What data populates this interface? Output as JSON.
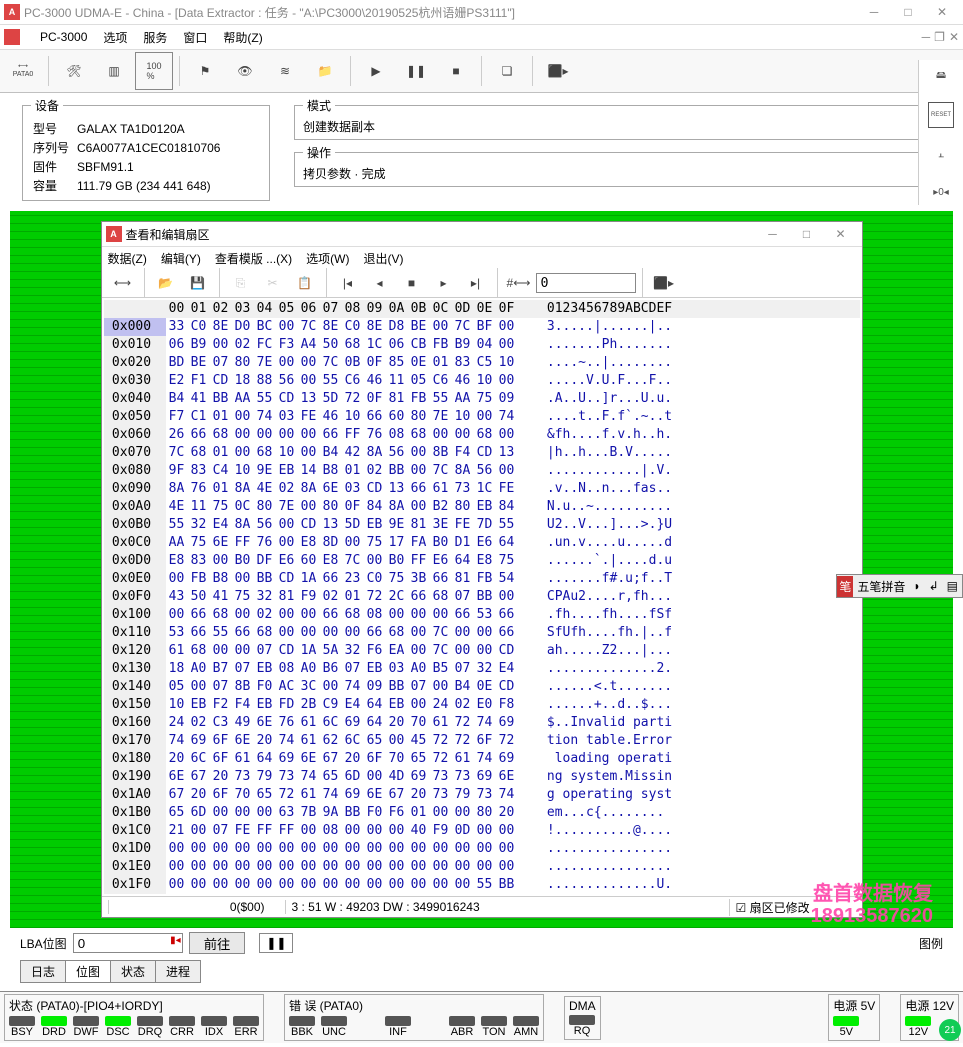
{
  "window": {
    "title": "PC-3000 UDMA-E - China - [Data Extractor : 任务 - \"A:\\PC3000\\20190525杭州语姗PS3111\"]"
  },
  "menu": {
    "main1": "PC-3000",
    "main2": "选项",
    "main3": "服务",
    "main4": "窗口",
    "main5": "帮助(Z)"
  },
  "device": {
    "legend": "设备",
    "model_k": "型号",
    "model_v": "GALAX TA1D0120A",
    "serial_k": "序列号",
    "serial_v": "C6A0077A1CEC01810706",
    "fw_k": "固件",
    "fw_v": "SBFM91.1",
    "cap_k": "容量",
    "cap_v": "111.79 GB (234 441 648)"
  },
  "mode": {
    "legend": "模式",
    "val": "创建数据副本"
  },
  "oper": {
    "legend": "操作",
    "val": "拷贝参数 · 完成"
  },
  "hexwin": {
    "title": "查看和编辑扇区",
    "m_data": "数据(Z)",
    "m_edit": "编辑(Y)",
    "m_tpl": "查看模版 ...(X)",
    "m_opt": "选项(W)",
    "m_exit": "退出(V)",
    "input": "0",
    "status_l": "0($00)",
    "status_m": "3 : 51 W : 49203 DW : 3499016243",
    "status_r": "扇区已修改"
  },
  "hex": {
    "hdr": "00 01 02 03 04 05 06 07 08 09 0A 0B 0C 0D 0E 0F  0123456789ABCDEF",
    "rows": [
      {
        "a": "0x000",
        "b": "33 C0 8E D0 BC 00 7C 8E C0 8E D8 BE 00 7C BF 00",
        "t": "3.....|......|.."
      },
      {
        "a": "0x010",
        "b": "06 B9 00 02 FC F3 A4 50 68 1C 06 CB FB B9 04 00",
        "t": ".......Ph......."
      },
      {
        "a": "0x020",
        "b": "BD BE 07 80 7E 00 00 7C 0B 0F 85 0E 01 83 C5 10",
        "t": "....~..|........"
      },
      {
        "a": "0x030",
        "b": "E2 F1 CD 18 88 56 00 55 C6 46 11 05 C6 46 10 00",
        "t": ".....V.U.F...F.."
      },
      {
        "a": "0x040",
        "b": "B4 41 BB AA 55 CD 13 5D 72 0F 81 FB 55 AA 75 09",
        "t": ".A..U..]r...U.u."
      },
      {
        "a": "0x050",
        "b": "F7 C1 01 00 74 03 FE 46 10 66 60 80 7E 10 00 74",
        "t": "....t..F.f`.~..t"
      },
      {
        "a": "0x060",
        "b": "26 66 68 00 00 00 00 66 FF 76 08 68 00 00 68 00",
        "t": "&fh....f.v.h..h."
      },
      {
        "a": "0x070",
        "b": "7C 68 01 00 68 10 00 B4 42 8A 56 00 8B F4 CD 13",
        "t": "|h..h...B.V....."
      },
      {
        "a": "0x080",
        "b": "9F 83 C4 10 9E EB 14 B8 01 02 BB 00 7C 8A 56 00",
        "t": "............|.V."
      },
      {
        "a": "0x090",
        "b": "8A 76 01 8A 4E 02 8A 6E 03 CD 13 66 61 73 1C FE",
        "t": ".v..N..n...fas.."
      },
      {
        "a": "0x0A0",
        "b": "4E 11 75 0C 80 7E 00 80 0F 84 8A 00 B2 80 EB 84",
        "t": "N.u..~.........."
      },
      {
        "a": "0x0B0",
        "b": "55 32 E4 8A 56 00 CD 13 5D EB 9E 81 3E FE 7D 55",
        "t": "U2..V...]...>.}U"
      },
      {
        "a": "0x0C0",
        "b": "AA 75 6E FF 76 00 E8 8D 00 75 17 FA B0 D1 E6 64",
        "t": ".un.v....u.....d"
      },
      {
        "a": "0x0D0",
        "b": "E8 83 00 B0 DF E6 60 E8 7C 00 B0 FF E6 64 E8 75",
        "t": "......`.|....d.u"
      },
      {
        "a": "0x0E0",
        "b": "00 FB B8 00 BB CD 1A 66 23 C0 75 3B 66 81 FB 54",
        "t": ".......f#.u;f..T"
      },
      {
        "a": "0x0F0",
        "b": "43 50 41 75 32 81 F9 02 01 72 2C 66 68 07 BB 00",
        "t": "CPAu2....r,fh..."
      },
      {
        "a": "0x100",
        "b": "00 66 68 00 02 00 00 66 68 08 00 00 00 66 53 66",
        "t": ".fh....fh....fSf"
      },
      {
        "a": "0x110",
        "b": "53 66 55 66 68 00 00 00 00 66 68 00 7C 00 00 66",
        "t": "SfUfh....fh.|..f"
      },
      {
        "a": "0x120",
        "b": "61 68 00 00 07 CD 1A 5A 32 F6 EA 00 7C 00 00 CD",
        "t": "ah.....Z2...|..."
      },
      {
        "a": "0x130",
        "b": "18 A0 B7 07 EB 08 A0 B6 07 EB 03 A0 B5 07 32 E4",
        "t": "..............2."
      },
      {
        "a": "0x140",
        "b": "05 00 07 8B F0 AC 3C 00 74 09 BB 07 00 B4 0E CD",
        "t": "......<.t......."
      },
      {
        "a": "0x150",
        "b": "10 EB F2 F4 EB FD 2B C9 E4 64 EB 00 24 02 E0 F8",
        "t": "......+..d..$..."
      },
      {
        "a": "0x160",
        "b": "24 02 C3 49 6E 76 61 6C 69 64 20 70 61 72 74 69",
        "t": "$..Invalid parti"
      },
      {
        "a": "0x170",
        "b": "74 69 6F 6E 20 74 61 62 6C 65 00 45 72 72 6F 72",
        "t": "tion table.Error"
      },
      {
        "a": "0x180",
        "b": "20 6C 6F 61 64 69 6E 67 20 6F 70 65 72 61 74 69",
        "t": " loading operati"
      },
      {
        "a": "0x190",
        "b": "6E 67 20 73 79 73 74 65 6D 00 4D 69 73 73 69 6E",
        "t": "ng system.Missin"
      },
      {
        "a": "0x1A0",
        "b": "67 20 6F 70 65 72 61 74 69 6E 67 20 73 79 73 74",
        "t": "g operating syst"
      },
      {
        "a": "0x1B0",
        "b": "65 6D 00 00 00 63 7B 9A BB F0 F6 01 00 00 80 20",
        "t": "em...c{........ "
      },
      {
        "a": "0x1C0",
        "b": "21 00 07 FE FF FF 00 08 00 00 00 40 F9 0D 00 00",
        "t": "!..........@...."
      },
      {
        "a": "0x1D0",
        "b": "00 00 00 00 00 00 00 00 00 00 00 00 00 00 00 00",
        "t": "................"
      },
      {
        "a": "0x1E0",
        "b": "00 00 00 00 00 00 00 00 00 00 00 00 00 00 00 00",
        "t": "................"
      },
      {
        "a": "0x1F0",
        "b": "00 00 00 00 00 00 00 00 00 00 00 00 00 00 55 BB",
        "t": "..............U."
      }
    ]
  },
  "lba": {
    "label": "LBA位图",
    "val": "0",
    "go": "前往",
    "legend": "图例"
  },
  "tabs": {
    "t1": "日志",
    "t2": "位图",
    "t3": "状态",
    "t4": "进程"
  },
  "status": {
    "s1": "状态 (PATA0)-[PIO4+IORDY]",
    "s2": "错 误 (PATA0)",
    "s3": "DMA",
    "s4": "电源 5V",
    "s5": "电源 12V",
    "l1": "BSY",
    "l2": "DRD",
    "l3": "DWF",
    "l4": "DSC",
    "l5": "DRQ",
    "l6": "CRR",
    "l7": "IDX",
    "l8": "ERR",
    "e1": "BBK",
    "e2": "UNC",
    "e3": "INF",
    "e4": "ABR",
    "e5": "TON",
    "e6": "AMN",
    "d1": "RQ",
    "p5": "5V",
    "p12": "12V"
  },
  "ime": {
    "label": "五笔拼音"
  },
  "watermark": {
    "l1": "盘首数据恢复",
    "l2": "18913587620"
  },
  "pill": "21"
}
